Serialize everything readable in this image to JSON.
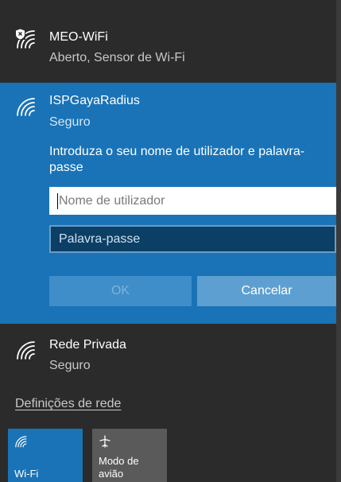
{
  "networks": {
    "meo": {
      "name": "MEO-WiFi",
      "status": "Aberto, Sensor de Wi-Fi",
      "icon": "wifi-shield-icon"
    },
    "selected": {
      "name": "ISPGayaRadius",
      "status": "Seguro",
      "icon": "wifi-icon",
      "prompt": "Introduza o seu nome de utilizador e palavra-passe",
      "username_placeholder": "Nome de utilizador",
      "username_value": "",
      "password_placeholder": "Palavra-passe",
      "password_value": "",
      "ok_label": "OK",
      "cancel_label": "Cancelar"
    },
    "rede": {
      "name": "Rede Privada",
      "status": "Seguro",
      "icon": "wifi-icon"
    }
  },
  "settings_link": "Definições de rede",
  "quick_actions": [
    {
      "label": "Wi-Fi",
      "icon": "wifi-icon",
      "active": true
    },
    {
      "label": "Modo de avião",
      "icon": "airplane-icon",
      "active": false
    }
  ],
  "colors": {
    "background": "#2b2b2b",
    "accent": "#1a73b6",
    "inactive_tile": "#5a5a5a"
  }
}
